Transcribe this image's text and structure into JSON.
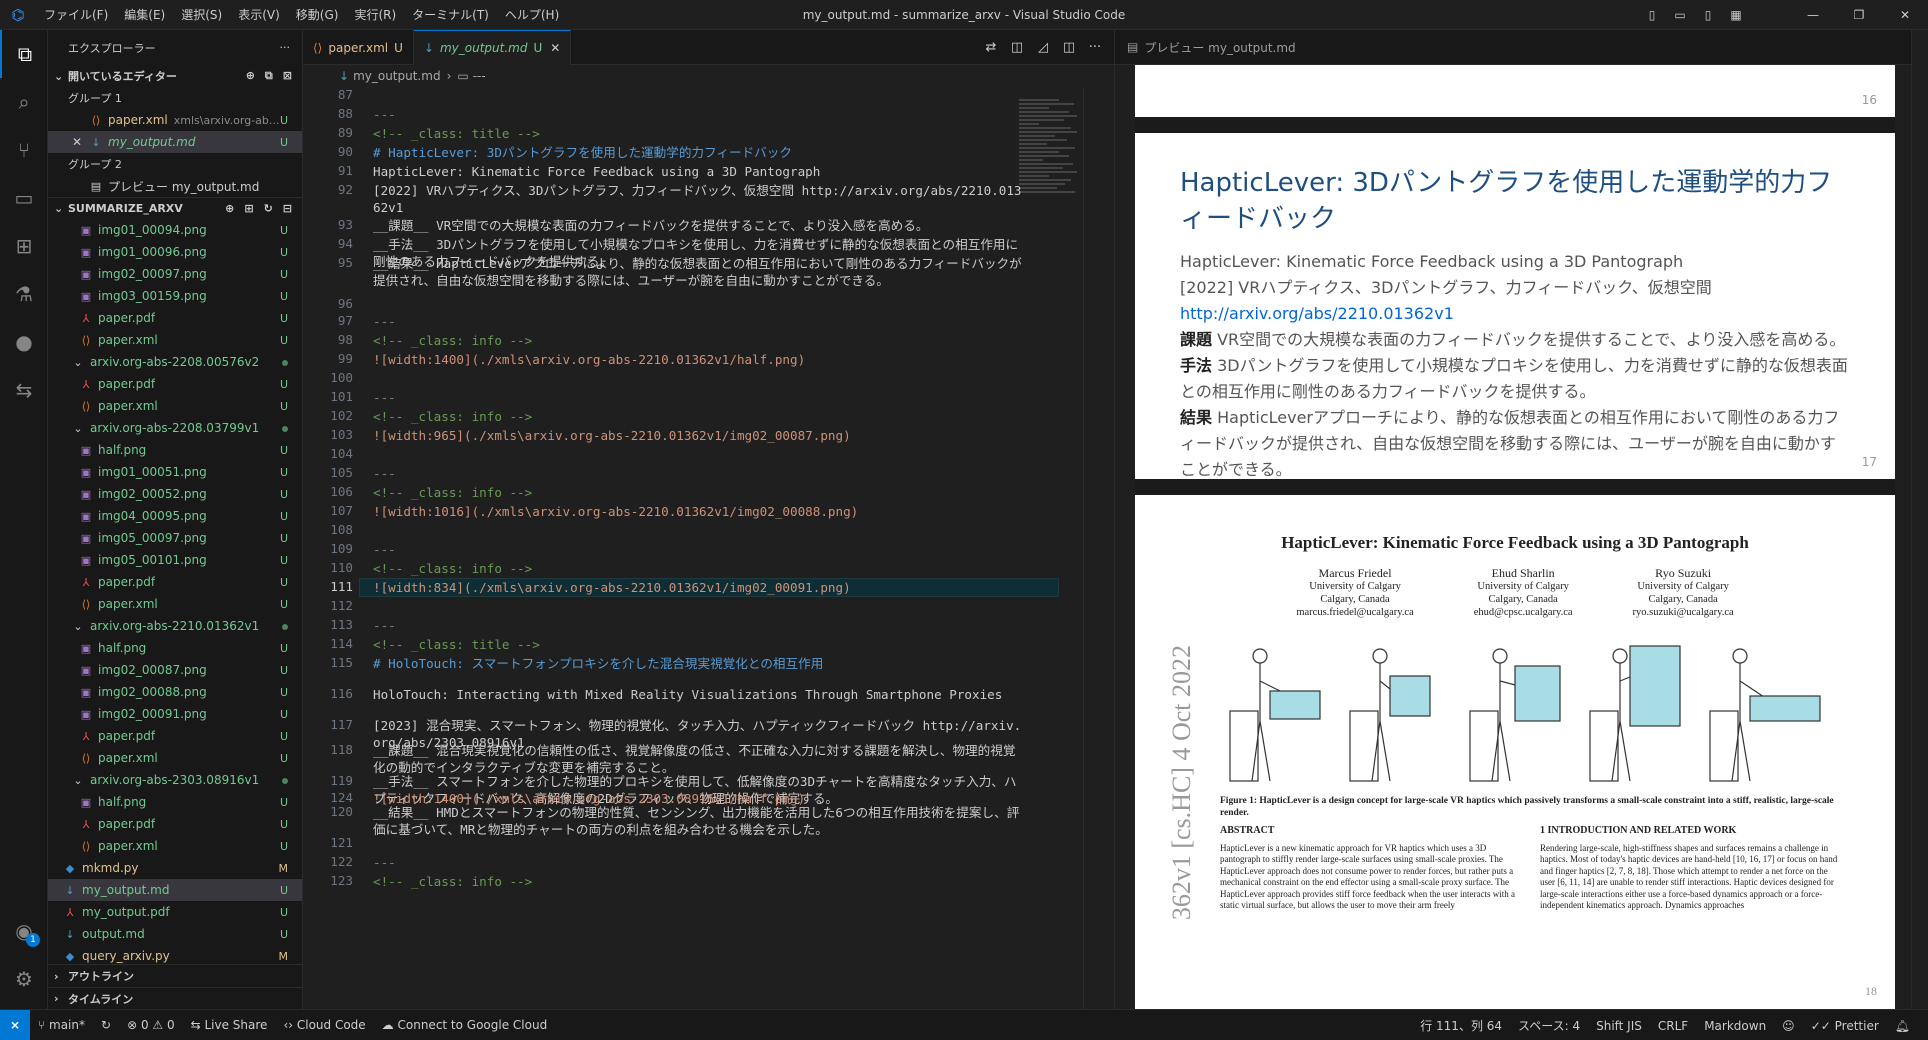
{
  "window": {
    "title": "my_output.md - summarize_arxv - Visual Studio Code",
    "logo": "vscode-logo"
  },
  "menu": [
    "ファイル(F)",
    "編集(E)",
    "選択(S)",
    "表示(V)",
    "移動(G)",
    "実行(R)",
    "ターミナル(T)",
    "ヘルプ(H)"
  ],
  "explorer": {
    "title": "エクスプローラー",
    "open_editors": {
      "label": "開いているエディター",
      "group1": "グループ 1",
      "group2": "グループ 2",
      "items": [
        {
          "name": "paper.xml",
          "desc": "xmls\\arxiv.org-ab...",
          "status": "U"
        },
        {
          "name": "my_output.md",
          "status": "U"
        },
        {
          "name": "プレビュー my_output.md"
        }
      ]
    },
    "workspace": "SUMMARIZE_ARXV",
    "tree": [
      {
        "name": "img01_00094.png",
        "status": "U",
        "type": "img"
      },
      {
        "name": "img01_00096.png",
        "status": "U",
        "type": "img"
      },
      {
        "name": "img02_00097.png",
        "status": "U",
        "type": "img"
      },
      {
        "name": "img03_00159.png",
        "status": "U",
        "type": "img"
      },
      {
        "name": "paper.pdf",
        "status": "U",
        "type": "pdf"
      },
      {
        "name": "paper.xml",
        "status": "U",
        "type": "xml"
      },
      {
        "name": "arxiv.org-abs-2208.00576v2",
        "type": "folder"
      },
      {
        "name": "paper.pdf",
        "status": "U",
        "type": "pdf"
      },
      {
        "name": "paper.xml",
        "status": "U",
        "type": "xml"
      },
      {
        "name": "arxiv.org-abs-2208.03799v1",
        "type": "folder"
      },
      {
        "name": "half.png",
        "status": "U",
        "type": "img"
      },
      {
        "name": "img01_00051.png",
        "status": "U",
        "type": "img"
      },
      {
        "name": "img02_00052.png",
        "status": "U",
        "type": "img"
      },
      {
        "name": "img04_00095.png",
        "status": "U",
        "type": "img"
      },
      {
        "name": "img05_00097.png",
        "status": "U",
        "type": "img"
      },
      {
        "name": "img05_00101.png",
        "status": "U",
        "type": "img"
      },
      {
        "name": "paper.pdf",
        "status": "U",
        "type": "pdf"
      },
      {
        "name": "paper.xml",
        "status": "U",
        "type": "xml"
      },
      {
        "name": "arxiv.org-abs-2210.01362v1",
        "type": "folder"
      },
      {
        "name": "half.png",
        "status": "U",
        "type": "img"
      },
      {
        "name": "img02_00087.png",
        "status": "U",
        "type": "img"
      },
      {
        "name": "img02_00088.png",
        "status": "U",
        "type": "img"
      },
      {
        "name": "img02_00091.png",
        "status": "U",
        "type": "img"
      },
      {
        "name": "paper.pdf",
        "status": "U",
        "type": "pdf"
      },
      {
        "name": "paper.xml",
        "status": "U",
        "type": "xml"
      },
      {
        "name": "arxiv.org-abs-2303.08916v1",
        "type": "folder"
      },
      {
        "name": "half.png",
        "status": "U",
        "type": "img"
      },
      {
        "name": "paper.pdf",
        "status": "U",
        "type": "pdf"
      },
      {
        "name": "paper.xml",
        "status": "U",
        "type": "xml"
      },
      {
        "name": "mkmd.py",
        "status": "M",
        "type": "py"
      },
      {
        "name": "my_output.md",
        "status": "U",
        "type": "md"
      },
      {
        "name": "my_output.pdf",
        "status": "U",
        "type": "pdf"
      },
      {
        "name": "output.md",
        "status": "U",
        "type": "md"
      },
      {
        "name": "query_arxiv.py",
        "status": "M",
        "type": "py"
      }
    ],
    "outline": "アウトライン",
    "timeline": "タイムライン"
  },
  "tabs": [
    {
      "name": "paper.xml",
      "status": "U"
    },
    {
      "name": "my_output.md",
      "status": "U"
    }
  ],
  "breadcrumb": {
    "file": "my_output.md",
    "sep": "›",
    "symbol": "---"
  },
  "code": [
    {
      "n": "87",
      "t": ""
    },
    {
      "n": "88",
      "t": "---"
    },
    {
      "n": "89",
      "t": "<!-- _class: title -->"
    },
    {
      "n": "90",
      "t": "# HapticLever: 3Dパントグラフを使用した運動学的力フィードバック"
    },
    {
      "n": "91",
      "t": "HapticLever: Kinematic Force Feedback using a 3D Pantograph"
    },
    {
      "n": "92",
      "t": "[2022] VRハプティクス、3Dパントグラフ、力フィードバック、仮想空間 http://arxiv.org/abs/2210.01362v1"
    },
    {
      "n": "93",
      "t": "__課題__ VR空間での大規模な表面の力フィードバックを提供することで、より没入感を高める。"
    },
    {
      "n": "94",
      "t": "__手法__ 3Dパントグラフを使用して小規模なプロキシを使用し、力を消費せずに静的な仮想表面との相互作用に剛性のある力フィードバックを提供する。"
    },
    {
      "n": "95",
      "t": "__結果__ HapticLeverアプローチにより、静的な仮想表面との相互作用において剛性のある力フィードバックが提供され、自由な仮想空間を移動する際には、ユーザーが腕を自由に動かすことができる。"
    },
    {
      "n": "96",
      "t": ""
    },
    {
      "n": "97",
      "t": "---"
    },
    {
      "n": "98",
      "t": "<!-- _class: info -->"
    },
    {
      "n": "99",
      "t": "![width:1400](./xmls\\arxiv.org-abs-2210.01362v1/half.png)"
    },
    {
      "n": "100",
      "t": ""
    },
    {
      "n": "101",
      "t": "---"
    },
    {
      "n": "102",
      "t": "<!-- _class: info -->"
    },
    {
      "n": "103",
      "t": "![width:965](./xmls\\arxiv.org-abs-2210.01362v1/img02_00087.png)"
    },
    {
      "n": "104",
      "t": ""
    },
    {
      "n": "105",
      "t": "---"
    },
    {
      "n": "106",
      "t": "<!-- _class: info -->"
    },
    {
      "n": "107",
      "t": "![width:1016](./xmls\\arxiv.org-abs-2210.01362v1/img02_00088.png)"
    },
    {
      "n": "108",
      "t": ""
    },
    {
      "n": "109",
      "t": "---"
    },
    {
      "n": "110",
      "t": "<!-- _class: info -->"
    },
    {
      "n": "111",
      "t": "![width:834](./xmls\\arxiv.org-abs-2210.01362v1/img02_00091.png)"
    },
    {
      "n": "112",
      "t": ""
    },
    {
      "n": "113",
      "t": "---"
    },
    {
      "n": "114",
      "t": "<!-- _class: title -->"
    },
    {
      "n": "115",
      "t": "# HoloTouch: スマートフォンプロキシを介した混合現実視覚化との相互作用"
    },
    {
      "n": "116",
      "t": "HoloTouch: Interacting with Mixed Reality Visualizations Through Smartphone Proxies"
    },
    {
      "n": "117",
      "t": "[2023] 混合現実、スマートフォン、物理的視覚化、タッチ入力、ハプティックフィードバック http://arxiv.org/abs/2303.08916v1"
    },
    {
      "n": "118",
      "t": "__課題__ 混合現実視覚化の信頼性の低さ、視覚解像度の低さ、不正確な入力に対する課題を解決し、物理的視覚化の動的でインタラクティブな変更を補完すること。"
    },
    {
      "n": "119",
      "t": "__手法__ スマートフォンを介した物理的プロキシを使用して、低解像度の3Dチャートを高精度なタッチ入力、ハプティックフィードバック、高解像度の2Dグラフィック、物理的操作で補完する。"
    },
    {
      "n": "120",
      "t": "__結果__ HMDとスマートフォンの物理的性質、センシング、出力機能を活用した6つの相互作用技術を提案し、評価に基づいて、MRと物理的チャートの両方の利点を組み合わせる機会を示した。"
    },
    {
      "n": "121",
      "t": ""
    },
    {
      "n": "122",
      "t": "---"
    },
    {
      "n": "123",
      "t": "<!-- _class: info -->"
    },
    {
      "n": "124",
      "t": "![width:1400](./xmls\\arxiv.org-abs-2303.08916v1/half.png)"
    }
  ],
  "preview": {
    "tab": "プレビュー my_output.md",
    "page16": "16",
    "page17": {
      "num": "17",
      "title": "HapticLever: 3Dパントグラフを使用した運動学的力フィードバック",
      "subtitle": "HapticLever: Kinematic Force Feedback using a 3D Pantograph",
      "meta": "[2022] VRハプティクス、3Dパントグラフ、力フィードバック、仮想空間",
      "link": "http://arxiv.org/abs/2210.01362v1",
      "k1": "課題",
      "v1": "VR空間での大規模な表面の力フィードバックを提供することで、より没入感を高める。",
      "k2": "手法",
      "v2": "3Dパントグラフを使用して小規模なプロキシを使用し、力を消費せずに静的な仮想表面との相互作用に剛性のある力フィードバックを提供する。",
      "k3": "結果",
      "v3": "HapticLeverアプローチにより、静的な仮想表面との相互作用において剛性のある力フィードバックが提供され、自由な仮想空間を移動する際には、ユーザーが腕を自由に動かすことができる。"
    },
    "page18": {
      "num": "18",
      "title": "HapticLever: Kinematic Force Feedback using a 3D Pantograph",
      "authors": [
        {
          "name": "Marcus Friedel",
          "org": "University of Calgary",
          "loc": "Calgary, Canada",
          "mail": "marcus.friedel@ucalgary.ca"
        },
        {
          "name": "Ehud Sharlin",
          "org": "University of Calgary",
          "loc": "Calgary, Canada",
          "mail": "ehud@cpsc.ucalgary.ca"
        },
        {
          "name": "Ryo Suzuki",
          "org": "University of Calgary",
          "loc": "Calgary, Canada",
          "mail": "ryo.suzuki@ucalgary.ca"
        }
      ],
      "arxiv": "362v1 [cs.HC] 4 Oct 2022",
      "caption": "Figure 1: HapticLever is a design concept for large-scale VR haptics which passively transforms a small-scale constraint into a stiff, realistic, large-scale render.",
      "abstract_h": "ABSTRACT",
      "abstract": "HapticLever is a new kinematic approach for VR haptics which uses a 3D pantograph to stiffly render large-scale surfaces using small-scale proxies. The HapticLever approach does not consume power to render forces, but rather puts a mechanical constraint on the end effector using a small-scale proxy surface. The HapticLever approach provides stiff force feedback when the user interacts with a static virtual surface, but allows the user to move their arm freely",
      "intro_h": "1   INTRODUCTION AND RELATED WORK",
      "intro": "Rendering large-scale, high-stiffness shapes and surfaces remains a challenge in haptics. Most of today's haptic devices are hand-held [10, 16, 17] or focus on hand and finger haptics [2, 7, 8, 18]. Those which attempt to render a net force on the user [6, 11, 14] are unable to render stiff interactions. Haptic devices designed for large-scale interactions either use a force-based dynamics approach or a force-independent kinematics approach. Dynamics approaches"
    }
  },
  "status": {
    "branch": "main*",
    "errors": "0",
    "warnings": "0",
    "live_share": "Live Share",
    "cloud_code": "Cloud Code",
    "google_cloud": "Connect to Google Cloud",
    "position": "行 111、列 64",
    "spaces": "スペース: 4",
    "encoding": "Shift JIS",
    "eol": "CRLF",
    "language": "Markdown",
    "prettier": "Prettier"
  },
  "accounts_badge": "1"
}
